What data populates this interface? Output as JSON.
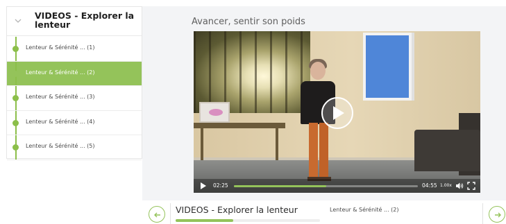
{
  "sidebar": {
    "title": "VIDEOS - Explorer la lenteur",
    "items": [
      {
        "label": "Lenteur & Sérénité ... (1)",
        "active": false
      },
      {
        "label": "Lenteur & Sérénité ... (2)",
        "active": true
      },
      {
        "label": "Lenteur & Sérénité ... (3)",
        "active": false
      },
      {
        "label": "Lenteur & Sérénité ... (4)",
        "active": false
      },
      {
        "label": "Lenteur & Sérénité ... (5)",
        "active": false
      }
    ]
  },
  "main": {
    "video_title": "Avancer, sentir son poids"
  },
  "player": {
    "current_time": "02:25",
    "duration": "04:55",
    "speed": "1.00x",
    "progress": 0.5
  },
  "bottom": {
    "course_title": "VIDEOS - Explorer la lenteur",
    "lesson_label": "Lenteur & Sérénité ... (2)",
    "course_progress": 0.4
  },
  "colors": {
    "accent": "#94c35a",
    "main_background": "#f3f4f6",
    "sidebar_background": "#ffffff"
  },
  "icons": {
    "sidebar_toggle": "chevron-down-icon",
    "big_play": "play-icon",
    "control_play": "play-icon",
    "volume": "volume-icon",
    "fullscreen": "fullscreen-icon",
    "prev": "arrow-left-icon",
    "next": "arrow-right-icon"
  }
}
